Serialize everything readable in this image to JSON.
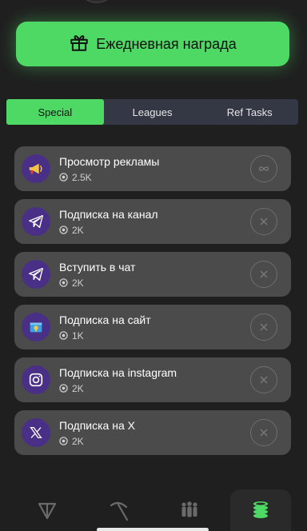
{
  "reward_button": {
    "label": "Ежедневная награда",
    "icon": "gift-icon"
  },
  "tabs": [
    {
      "label": "Special",
      "active": true
    },
    {
      "label": "Leagues",
      "active": false
    },
    {
      "label": "Ref Tasks",
      "active": false
    }
  ],
  "tasks": [
    {
      "title": "Просмотр рекламы",
      "reward": "2.5K",
      "icon": "megaphone-icon",
      "action": "infinity-icon"
    },
    {
      "title": "Подписка на канал",
      "reward": "2K",
      "icon": "telegram-icon",
      "action": "close-icon"
    },
    {
      "title": "Вступить в чат",
      "reward": "2K",
      "icon": "telegram-icon",
      "action": "close-icon"
    },
    {
      "title": "Подписка на сайт",
      "reward": "1K",
      "icon": "website-icon",
      "action": "close-icon"
    },
    {
      "title": "Подписка на instagram",
      "reward": "2K",
      "icon": "instagram-icon",
      "action": "close-icon"
    },
    {
      "title": "Подписка на X",
      "reward": "2K",
      "icon": "x-logo-icon",
      "action": "close-icon"
    }
  ],
  "bottom_nav": [
    {
      "icon": "ton-icon",
      "active": false
    },
    {
      "icon": "pickaxe-icon",
      "active": false
    },
    {
      "icon": "friends-icon",
      "active": false
    },
    {
      "icon": "coins-icon",
      "active": true
    }
  ],
  "colors": {
    "accent": "#4ed964",
    "background": "#1f1f1f",
    "card": "#4b4b4b",
    "icon_bg": "#4a2f86",
    "tab_bg": "#343844"
  }
}
